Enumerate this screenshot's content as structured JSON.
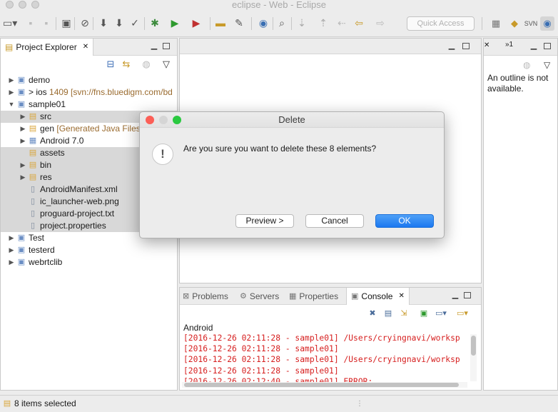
{
  "window": {
    "title": "eclipse - Web - Eclipse"
  },
  "toolbar": {
    "quick_access_placeholder": "Quick Access",
    "perspectives": [
      "java-perspective-icon",
      "git-perspective-icon",
      "svn-perspective-icon",
      "web-perspective-icon"
    ]
  },
  "explorer": {
    "tab_label": "Project Explorer",
    "tab_close": "✕",
    "tree": [
      {
        "label": "demo",
        "deco": "",
        "indent": 0,
        "twisty": "▶",
        "icon": "▣",
        "selected": false
      },
      {
        "label": "> ios",
        "deco": " 1409 [svn://fns.bluedigm.com/bd",
        "indent": 0,
        "twisty": "▶",
        "icon": "▣",
        "selected": false
      },
      {
        "label": "sample01",
        "deco": "",
        "indent": 0,
        "twisty": "▼",
        "icon": "▣",
        "selected": false
      },
      {
        "label": "src",
        "deco": "",
        "indent": 1,
        "twisty": "▶",
        "icon": "▤",
        "selected": true
      },
      {
        "label": "gen",
        "deco": " [Generated Java Files]",
        "indent": 1,
        "twisty": "▶",
        "icon": "▤",
        "selected": false
      },
      {
        "label": "Android 7.0",
        "deco": "",
        "indent": 1,
        "twisty": "▶",
        "icon": "▦",
        "selected": false
      },
      {
        "label": "assets",
        "deco": "",
        "indent": 1,
        "twisty": "",
        "icon": "▤",
        "selected": true
      },
      {
        "label": "bin",
        "deco": "",
        "indent": 1,
        "twisty": "▶",
        "icon": "▤",
        "selected": true
      },
      {
        "label": "res",
        "deco": "",
        "indent": 1,
        "twisty": "▶",
        "icon": "▤",
        "selected": true
      },
      {
        "label": "AndroidManifest.xml",
        "deco": "",
        "indent": 1,
        "twisty": "",
        "icon": "▯",
        "selected": true
      },
      {
        "label": "ic_launcher-web.png",
        "deco": "",
        "indent": 1,
        "twisty": "",
        "icon": "▯",
        "selected": true
      },
      {
        "label": "proguard-project.txt",
        "deco": "",
        "indent": 1,
        "twisty": "",
        "icon": "▯",
        "selected": true
      },
      {
        "label": "project.properties",
        "deco": "",
        "indent": 1,
        "twisty": "",
        "icon": "▯",
        "selected": true
      },
      {
        "label": "Test",
        "deco": "",
        "indent": 0,
        "twisty": "▶",
        "icon": "▣",
        "selected": false
      },
      {
        "label": "testerd",
        "deco": "",
        "indent": 0,
        "twisty": "▶",
        "icon": "▣",
        "selected": false
      },
      {
        "label": "webrtclib",
        "deco": "",
        "indent": 0,
        "twisty": "▶",
        "icon": "▣",
        "selected": false
      }
    ]
  },
  "outline": {
    "tab_overflow": "»1",
    "message": "An outline is not available."
  },
  "console": {
    "tabs": [
      {
        "label": "Problems",
        "active": false
      },
      {
        "label": "Servers",
        "active": false
      },
      {
        "label": "Properties",
        "active": false
      },
      {
        "label": "Console",
        "active": true
      }
    ],
    "tab_close": "✕",
    "name": "Android",
    "lines": [
      "[2016-12-26 02:11:28 - sample01] /Users/cryingnavi/worksp",
      "[2016-12-26 02:11:28 - sample01]",
      "[2016-12-26 02:11:28 - sample01] /Users/cryingnavi/worksp",
      "[2016-12-26 02:11:28 - sample01]",
      "[2016-12-26 02:12:40 - sample01] ERROR: ..."
    ]
  },
  "status": {
    "text": "8 items selected"
  },
  "dialog": {
    "title": "Delete",
    "message": "Are you sure you want to delete these 8 elements?",
    "buttons": {
      "preview": "Preview >",
      "cancel": "Cancel",
      "ok": "OK"
    },
    "colors": {
      "close": "#fc5f57",
      "minimize": "#d5d5d5",
      "zoom": "#2ac940",
      "primary": "#1c78f0"
    }
  }
}
